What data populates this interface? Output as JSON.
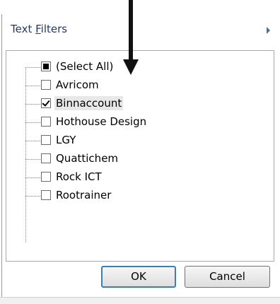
{
  "menu": {
    "title_prefix": "Text ",
    "title_accel": "F",
    "title_suffix": "ilters",
    "submenu_icon": "triangle-right-icon"
  },
  "filter_list": {
    "items": [
      {
        "label": "(Select All)",
        "state": "partial"
      },
      {
        "label": "Avricom",
        "state": "unchecked"
      },
      {
        "label": "Binnaccount",
        "state": "checked",
        "selected": true
      },
      {
        "label": "Hothouse Design",
        "state": "unchecked"
      },
      {
        "label": "LGY",
        "state": "unchecked"
      },
      {
        "label": "Quattichem",
        "state": "unchecked"
      },
      {
        "label": "Rock ICT",
        "state": "unchecked"
      },
      {
        "label": "Rootrainer",
        "state": "unchecked"
      }
    ]
  },
  "buttons": {
    "ok_label": "OK",
    "cancel_label": "Cancel"
  },
  "colors": {
    "menu_text": "#1f3b6e",
    "ok_border": "#3c7fb1",
    "annotation_arrow": "#111111"
  }
}
